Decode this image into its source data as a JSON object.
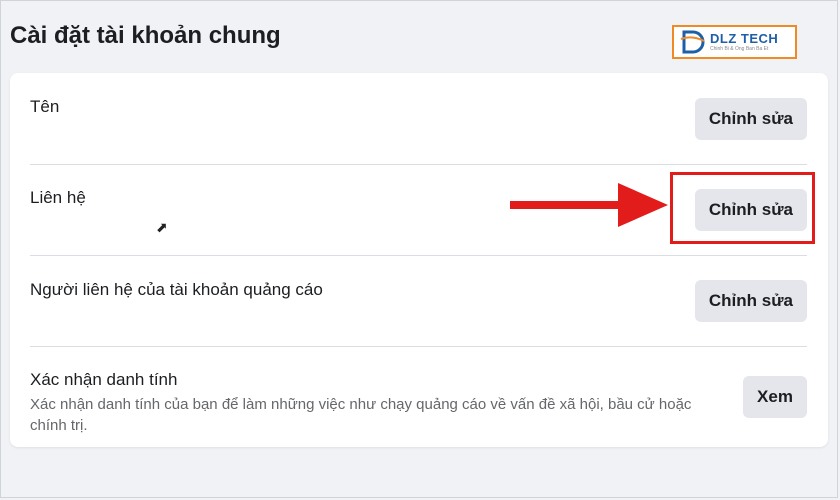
{
  "page_title": "Cài đặt tài khoản chung",
  "logo": {
    "name": "DLZ TECH",
    "tagline": "Chinh Bi & Ong Ban Ba Et"
  },
  "rows": [
    {
      "title": "Tên",
      "button": "Chỉnh sửa"
    },
    {
      "title": "Liên hệ",
      "button": "Chỉnh sửa"
    },
    {
      "title": "Người liên hệ của tài khoản quảng cáo",
      "button": "Chỉnh sửa"
    },
    {
      "title": "Xác nhận danh tính",
      "description": "Xác nhận danh tính của bạn để làm những việc như chạy quảng cáo về vấn đề xã hội, bầu cử hoặc chính trị.",
      "button": "Xem"
    }
  ],
  "colors": {
    "annotation_red": "#e21b1b",
    "button_bg": "#e4e6eb",
    "logo_border": "#f08a24",
    "logo_blue": "#1e5fa8"
  }
}
